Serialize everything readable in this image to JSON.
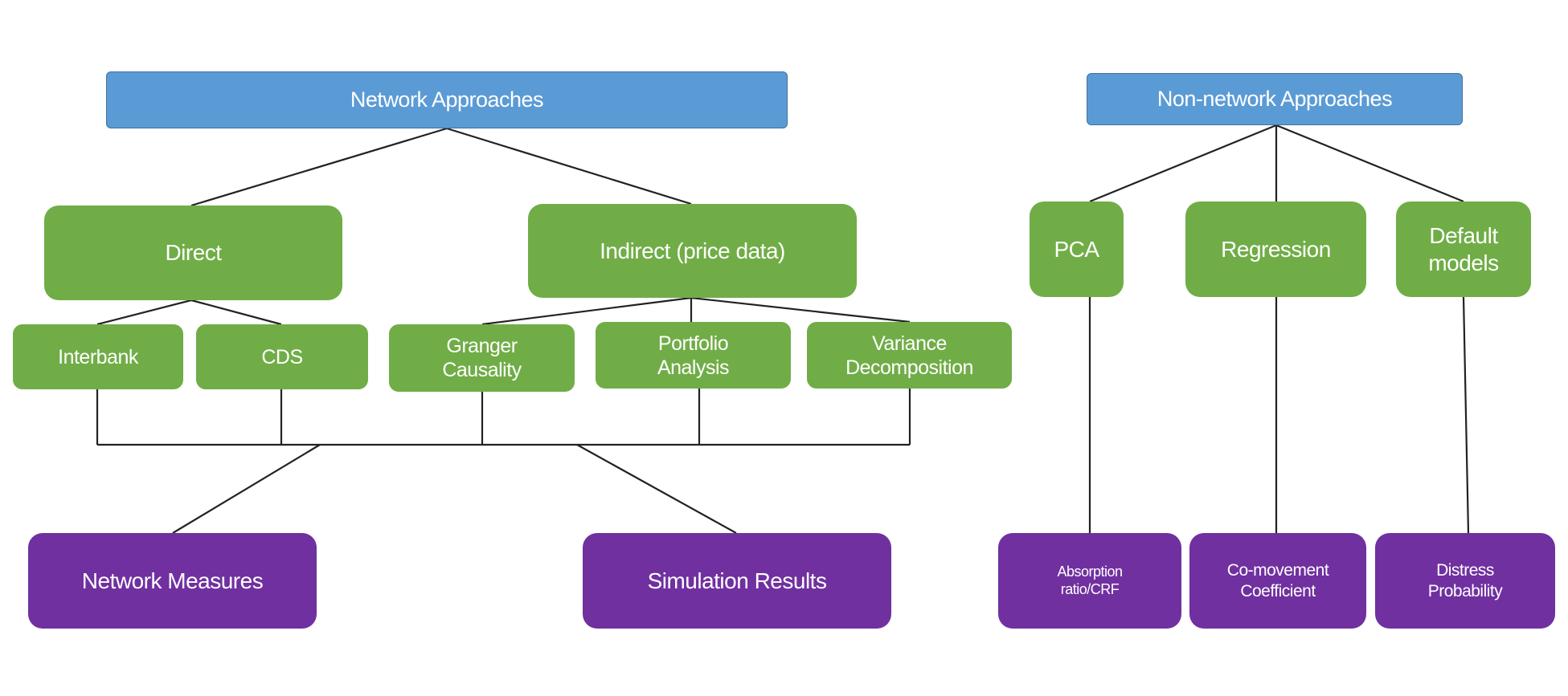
{
  "colors": {
    "root": "#5b9bd5",
    "method": "#70ad47",
    "output": "#7030a0"
  },
  "network": {
    "title": "Network Approaches",
    "direct": "Direct",
    "indirect": "Indirect (price data)",
    "interbank": "Interbank",
    "cds": "CDS",
    "granger": "Granger Causality",
    "portfolio": "Portfolio Analysis",
    "variance": "Variance Decomposition",
    "measures": "Network Measures",
    "simulation": "Simulation Results"
  },
  "non_network": {
    "title": "Non-network Approaches",
    "pca": "PCA",
    "regression": "Regression",
    "default_models": "Default models",
    "absorption": "Absorption ratio/CRF",
    "comovement": "Co-movement Coefficient",
    "distress": "Distress Probability"
  }
}
